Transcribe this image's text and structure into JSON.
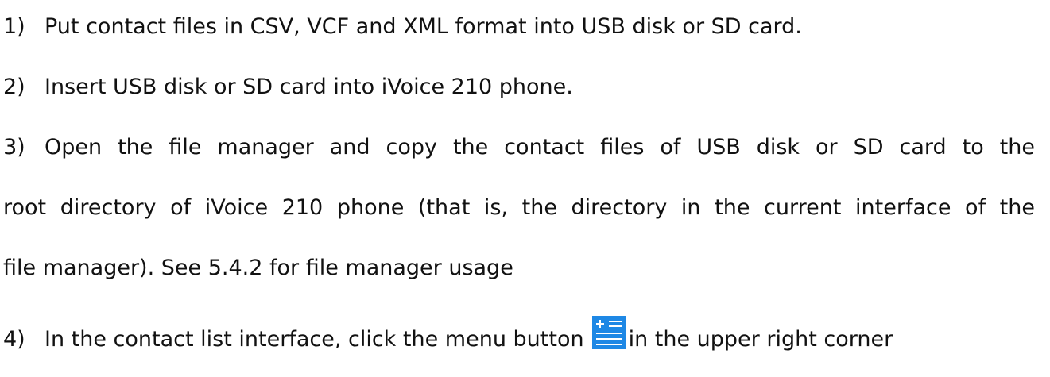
{
  "steps": [
    {
      "num": "1)",
      "text": "Put contact files in CSV, VCF and XML format into USB disk or SD card."
    },
    {
      "num": "2)",
      "text": "Insert USB disk or SD card into iVoice 210 phone."
    },
    {
      "num": "3)",
      "text": "Open the file manager and copy the contact files of USB disk or SD card to the"
    },
    {
      "num": "",
      "text": "root directory of iVoice 210 phone (that is, the directory in the current interface of the"
    },
    {
      "num": "",
      "text": "file manager). See 5.4.2 for file manager usage"
    },
    {
      "num": "4)",
      "text_before_icon": "In the contact list interface, click the menu button",
      "text_after_icon": "in the upper right corner"
    }
  ],
  "icons": {
    "menu_button_icon": {
      "name": "menu-add-list-icon",
      "color": "#1e88e5"
    }
  }
}
